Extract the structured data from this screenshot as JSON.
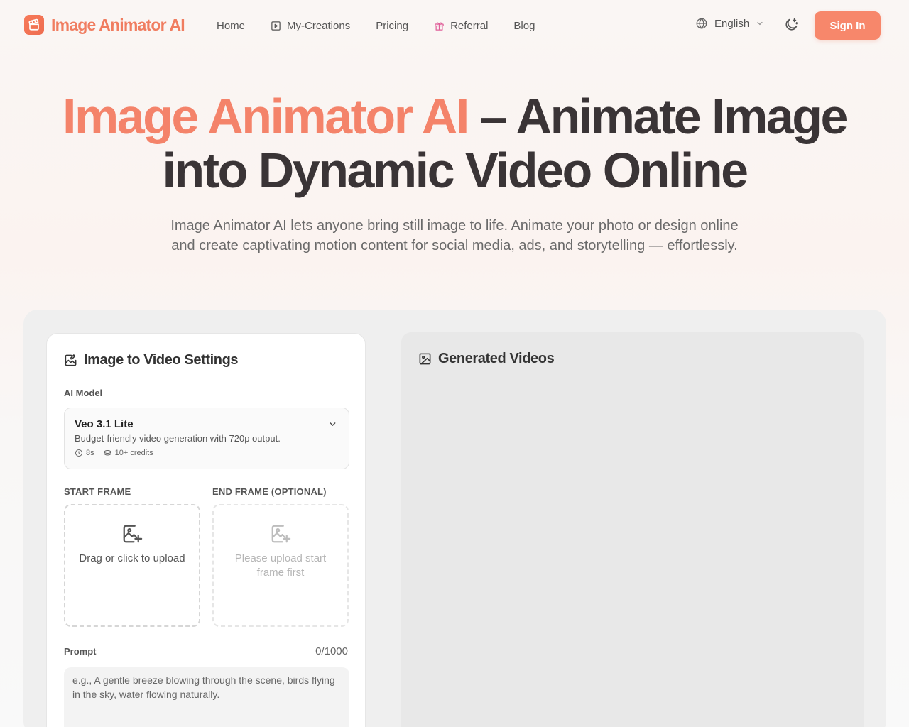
{
  "brand": {
    "name": "Image Animator AI",
    "accent": "#f4836a"
  },
  "nav": {
    "links": [
      {
        "label": "Home",
        "icon": ""
      },
      {
        "label": "My-Creations",
        "icon": "play-square-icon"
      },
      {
        "label": "Pricing",
        "icon": ""
      },
      {
        "label": "Referral",
        "icon": "gift-icon"
      },
      {
        "label": "Blog",
        "icon": ""
      }
    ],
    "language": "English",
    "sign_in": "Sign In"
  },
  "hero": {
    "title_accent": "Image Animator AI",
    "title_rest_line1": " – Animate Image",
    "title_line2": "into Dynamic Video Online",
    "subtitle": "Image Animator AI lets anyone bring still image to life. Animate your photo or design online and create captivating motion content for social media, ads, and storytelling — effortlessly."
  },
  "settings": {
    "heading": "Image to Video Settings",
    "model_label": "AI Model",
    "model": {
      "name": "Veo 3.1 Lite",
      "description": "Budget-friendly video generation with 720p output.",
      "duration": "8s",
      "credits": "10+ credits"
    },
    "start_frame": {
      "label": "START FRAME",
      "text": "Drag or click to upload"
    },
    "end_frame": {
      "label": "END FRAME (OPTIONAL)",
      "text": "Please upload start frame first"
    },
    "prompt": {
      "label": "Prompt",
      "count": "0/1000",
      "placeholder": "e.g., A gentle breeze blowing through the scene, birds flying in the sky, water flowing naturally."
    }
  },
  "videos": {
    "heading": "Generated Videos"
  }
}
